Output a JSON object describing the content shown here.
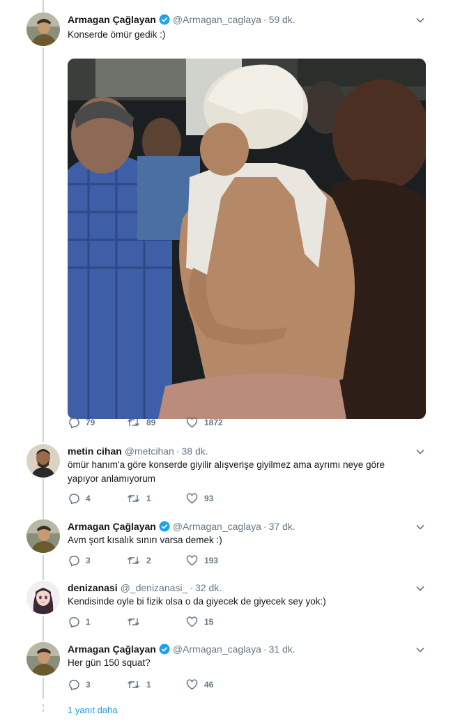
{
  "tweets": [
    {
      "name": "Armagan Çağlayan",
      "verified": true,
      "handle": "@Armagan_caglaya",
      "time": "59 dk.",
      "text": "Konserde ömür gedik :)",
      "replies": "79",
      "retweets": "89",
      "likes": "1872"
    },
    {
      "name": "metin cihan",
      "verified": false,
      "handle": "@metcihan",
      "time": "38 dk.",
      "text_line1": "ömür hanım'a göre konserde giyilir alışverişe giyilmez ama ayrımı neye göre",
      "text_line2": "yapıyor anlamıyorum",
      "replies": "4",
      "retweets": "1",
      "likes": "93"
    },
    {
      "name": "Armagan Çağlayan",
      "verified": true,
      "handle": "@Armagan_caglaya",
      "time": "37 dk.",
      "text": "Avm şort kısalık sınırı varsa demek :)",
      "replies": "3",
      "retweets": "2",
      "likes": "193"
    },
    {
      "name": "denizanasi",
      "verified": false,
      "handle": "@_denizanasi_",
      "time": "32 dk.",
      "text": "Kendisinde oyle bi fizik olsa o da giyecek de giyecek sey yok:)",
      "replies": "1",
      "retweets": "",
      "likes": "15"
    },
    {
      "name": "Armagan Çağlayan",
      "verified": true,
      "handle": "@Armagan_caglaya",
      "time": "31 dk.",
      "text": "Her gün 150 squat?",
      "replies": "3",
      "retweets": "1",
      "likes": "46"
    }
  ],
  "more_replies": "1 yanıt daha",
  "separator": "·",
  "colors": {
    "accent": "#1da1f2",
    "muted": "#657786",
    "thread_line": "#ccd6dd"
  }
}
